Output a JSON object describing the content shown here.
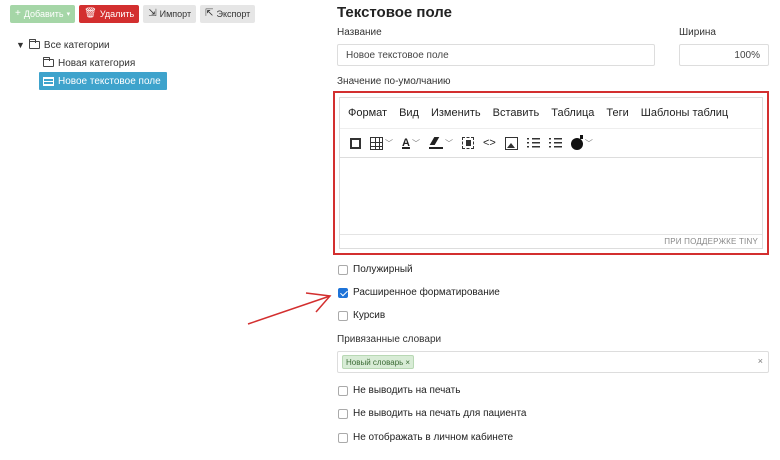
{
  "toolbar": {
    "add_label": "Добавить",
    "delete_label": "Удалить",
    "import_label": "Импорт",
    "export_label": "Экспорт"
  },
  "tree": {
    "root_label": "Все категории",
    "child_label": "Новая категория",
    "selected_label": "Новое текстовое поле"
  },
  "form": {
    "title": "Текстовое поле",
    "name_label": "Название",
    "name_value": "Новое текстовое поле",
    "width_label": "Ширина",
    "width_value": "100%",
    "default_label": "Значение по-умолчанию"
  },
  "editor": {
    "menu": [
      "Формат",
      "Вид",
      "Изменить",
      "Вставить",
      "Таблица",
      "Теги",
      "Шаблоны таблиц"
    ],
    "color_letter": "A",
    "code_glyph": "<>",
    "status": "ПРИ ПОДДЕРЖКЕ TINY"
  },
  "checkboxes": [
    {
      "label": "Полужирный",
      "checked": false
    },
    {
      "label": "Расширенное форматирование",
      "checked": true
    },
    {
      "label": "Курсив",
      "checked": false
    }
  ],
  "dictionaries": {
    "label": "Привязанные словари",
    "tag_label": "Новый словарь",
    "tag_remove": "×",
    "clear": "×"
  },
  "print_options": [
    {
      "label": "Не выводить на печать",
      "checked": false
    },
    {
      "label": "Не выводить на печать для пациента",
      "checked": false
    },
    {
      "label": "Не отображать в личном кабинете",
      "checked": false
    }
  ],
  "colors": {
    "add": "#a5d6a7",
    "delete": "#d32f2f",
    "selected": "#3ea3cc",
    "highlight_border": "#d32f2f",
    "checkbox_checked": "#1e73d8"
  }
}
